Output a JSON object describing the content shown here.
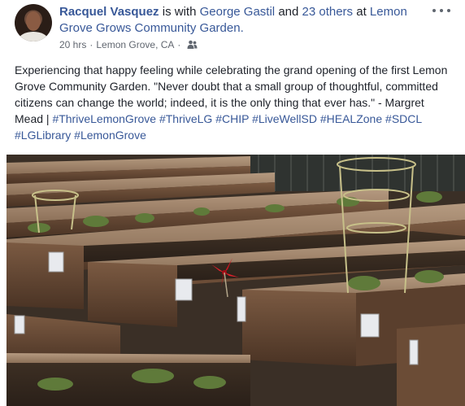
{
  "post": {
    "author": "Racquel Vasquez",
    "with_connector": "is with",
    "tagged_person": "George Gastil",
    "and_connector": "and",
    "others_link": "23 others",
    "at_connector": "at",
    "location_page": "Lemon Grove Grows Community Garden.",
    "timestamp": "20 hrs",
    "separator": "·",
    "place": "Lemon Grove, CA",
    "audience_icon": "people-icon",
    "more_icon": "more-options-icon",
    "text": "Experiencing that happy feeling while celebrating the grand opening of the first Lemon Grove Community Garden. \"Never doubt that a small group of thoughtful, committed citizens can change the world; indeed, it is the only thing that ever has.\" - Margret Mead | ",
    "hashtags": [
      "#ThriveLemonGrove",
      "#ThriveLG",
      "#CHIP",
      "#LiveWellSD",
      "#HEALZone",
      "#SDCL",
      "#LGLibrary",
      "#LemonGrove"
    ],
    "photo_subject": "raised-garden-beds"
  },
  "colors": {
    "link": "#385898",
    "text": "#1d2129",
    "meta": "#616770"
  }
}
